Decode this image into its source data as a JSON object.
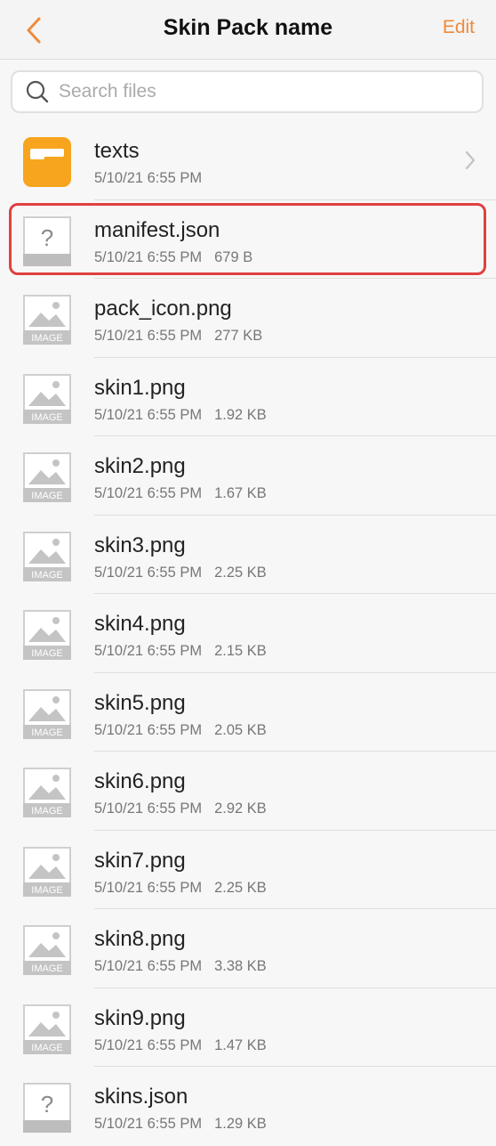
{
  "header": {
    "title": "Skin Pack name",
    "edit_label": "Edit",
    "accent_color": "#ef8a3a"
  },
  "search": {
    "placeholder": "Search files",
    "value": ""
  },
  "files": [
    {
      "name": "texts",
      "date": "5/10/21 6:55 PM",
      "size": "",
      "type": "folder"
    },
    {
      "name": "manifest.json",
      "date": "5/10/21 6:55 PM",
      "size": "679 B",
      "type": "unknown"
    },
    {
      "name": "pack_icon.png",
      "date": "5/10/21 6:55 PM",
      "size": "277 KB",
      "type": "image"
    },
    {
      "name": "skin1.png",
      "date": "5/10/21 6:55 PM",
      "size": "1.92 KB",
      "type": "image"
    },
    {
      "name": "skin2.png",
      "date": "5/10/21 6:55 PM",
      "size": "1.67 KB",
      "type": "image"
    },
    {
      "name": "skin3.png",
      "date": "5/10/21 6:55 PM",
      "size": "2.25 KB",
      "type": "image"
    },
    {
      "name": "skin4.png",
      "date": "5/10/21 6:55 PM",
      "size": "2.15 KB",
      "type": "image"
    },
    {
      "name": "skin5.png",
      "date": "5/10/21 6:55 PM",
      "size": "2.05 KB",
      "type": "image"
    },
    {
      "name": "skin6.png",
      "date": "5/10/21 6:55 PM",
      "size": "2.92 KB",
      "type": "image"
    },
    {
      "name": "skin7.png",
      "date": "5/10/21 6:55 PM",
      "size": "2.25 KB",
      "type": "image"
    },
    {
      "name": "skin8.png",
      "date": "5/10/21 6:55 PM",
      "size": "3.38 KB",
      "type": "image"
    },
    {
      "name": "skin9.png",
      "date": "5/10/21 6:55 PM",
      "size": "1.47 KB",
      "type": "image"
    },
    {
      "name": "skins.json",
      "date": "5/10/21 6:55 PM",
      "size": "1.29 KB",
      "type": "unknown"
    }
  ],
  "image_icon_label": "IMAGE",
  "unknown_icon_label": "?",
  "highlight_color": "#e04040",
  "highlighted_file": "manifest.json"
}
